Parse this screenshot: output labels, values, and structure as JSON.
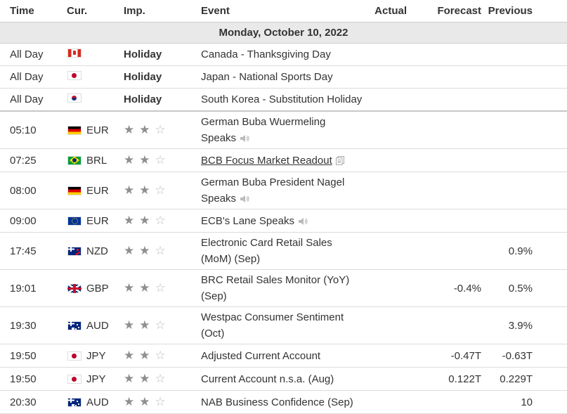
{
  "headers": {
    "time": "Time",
    "currency": "Cur.",
    "importance": "Imp.",
    "event": "Event",
    "actual": "Actual",
    "forecast": "Forecast",
    "previous": "Previous"
  },
  "date_label": "Monday, October 10, 2022",
  "holidays": [
    {
      "time": "All Day",
      "flag": "ca",
      "importance": "Holiday",
      "event": "Canada - Thanksgiving Day"
    },
    {
      "time": "All Day",
      "flag": "jp",
      "importance": "Holiday",
      "event": "Japan - National Sports Day"
    },
    {
      "time": "All Day",
      "flag": "kr",
      "importance": "Holiday",
      "event": "South Korea - Substitution Holiday"
    }
  ],
  "events": [
    {
      "time": "05:10",
      "flag": "de",
      "currency": "EUR",
      "stars": 2,
      "event_line1": "German Buba Wuermeling",
      "event_line2": "Speaks",
      "icon": "speaker-icon",
      "actual": "",
      "forecast": "",
      "previous": ""
    },
    {
      "time": "07:25",
      "flag": "br",
      "currency": "BRL",
      "stars": 2,
      "event_line1": "BCB Focus Market Readout",
      "event_line2": "",
      "icon": "document-icon",
      "link": true,
      "actual": "",
      "forecast": "",
      "previous": ""
    },
    {
      "time": "08:00",
      "flag": "de",
      "currency": "EUR",
      "stars": 2,
      "event_line1": "German Buba President Nagel",
      "event_line2": "Speaks",
      "icon": "speaker-icon",
      "actual": "",
      "forecast": "",
      "previous": ""
    },
    {
      "time": "09:00",
      "flag": "eu",
      "currency": "EUR",
      "stars": 2,
      "event_line1": "ECB's Lane Speaks",
      "event_line2": "",
      "icon": "speaker-icon",
      "actual": "",
      "forecast": "",
      "previous": ""
    },
    {
      "time": "17:45",
      "flag": "nz",
      "currency": "NZD",
      "stars": 2,
      "event_line1": "Electronic Card Retail Sales",
      "event_line2": "(MoM) (Sep)",
      "icon": "",
      "actual": "",
      "forecast": "",
      "previous": "0.9%"
    },
    {
      "time": "19:01",
      "flag": "gb",
      "currency": "GBP",
      "stars": 2,
      "event_line1": "BRC Retail Sales Monitor (YoY)",
      "event_line2": "(Sep)",
      "icon": "",
      "actual": "",
      "forecast": "-0.4%",
      "previous": "0.5%"
    },
    {
      "time": "19:30",
      "flag": "au",
      "currency": "AUD",
      "stars": 2,
      "event_line1": "Westpac Consumer Sentiment",
      "event_line2": "(Oct)",
      "icon": "",
      "actual": "",
      "forecast": "",
      "previous": "3.9%"
    },
    {
      "time": "19:50",
      "flag": "jp",
      "currency": "JPY",
      "stars": 2,
      "event_line1": "Adjusted Current Account",
      "event_line2": "",
      "icon": "",
      "actual": "",
      "forecast": "-0.47T",
      "previous": "-0.63T"
    },
    {
      "time": "19:50",
      "flag": "jp",
      "currency": "JPY",
      "stars": 2,
      "event_line1": "Current Account n.s.a. (Aug)",
      "event_line2": "",
      "icon": "",
      "actual": "",
      "forecast": "0.122T",
      "previous": "0.229T"
    },
    {
      "time": "20:30",
      "flag": "au",
      "currency": "AUD",
      "stars": 2,
      "event_line1": "NAB Business Confidence (Sep)",
      "event_line2": "",
      "icon": "",
      "actual": "",
      "forecast": "",
      "previous": "10"
    }
  ]
}
